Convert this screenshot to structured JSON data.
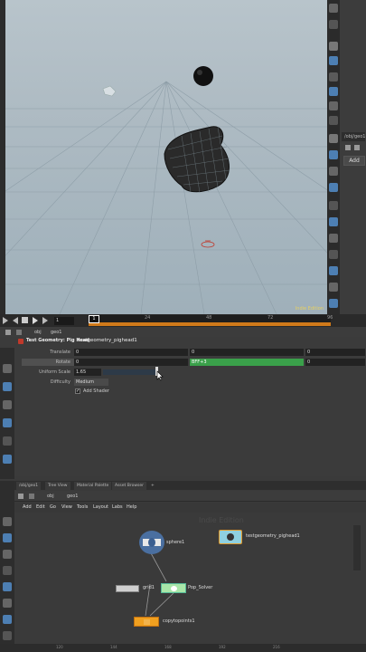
{
  "viewport": {
    "watermark": "Indie Edition",
    "far_right_tab": "/obj/geo1",
    "add_button": "Add"
  },
  "timeline": {
    "current_frame": "1",
    "frame_field": "1",
    "ticks": [
      "24",
      "48",
      "72",
      "96"
    ]
  },
  "param_nav": {
    "path_1": "obj",
    "path_2": "geo1"
  },
  "params": {
    "node_type": "Test Geometry: Pig Head",
    "node_name": "testgeometry_pighead1",
    "translate_label": "Translate",
    "translate": [
      "0",
      "0",
      "0"
    ],
    "rotate_label": "Rotate",
    "rotate": [
      "0",
      "BFF+3",
      "0"
    ],
    "uniform_scale_label": "Uniform Scale",
    "uniform_scale": "1.65",
    "difficulty_label": "Difficulty",
    "difficulty_value": "Medium",
    "add_shader_label": "Add Shader",
    "add_shader_checked": true,
    "accent_green": "#3aa04a"
  },
  "network": {
    "tabs": [
      "/obj/geo1",
      "Tree View",
      "Material Palette",
      "Asset Browser",
      "+"
    ],
    "path_1": "obj",
    "path_2": "geo1",
    "menu": [
      "Add",
      "Edit",
      "Go",
      "View",
      "Tools",
      "Layout",
      "Labs",
      "Help"
    ],
    "watermark": "Indie Edition",
    "nodes": {
      "sphere": "sphere1",
      "pighead": "testgeometry_pighead1",
      "grid": "grid1",
      "pop_solver": "Pop_Solver",
      "copytopoints": "copytopoints1"
    },
    "footer_ticks": [
      "120",
      "144",
      "168",
      "192",
      "216"
    ]
  }
}
